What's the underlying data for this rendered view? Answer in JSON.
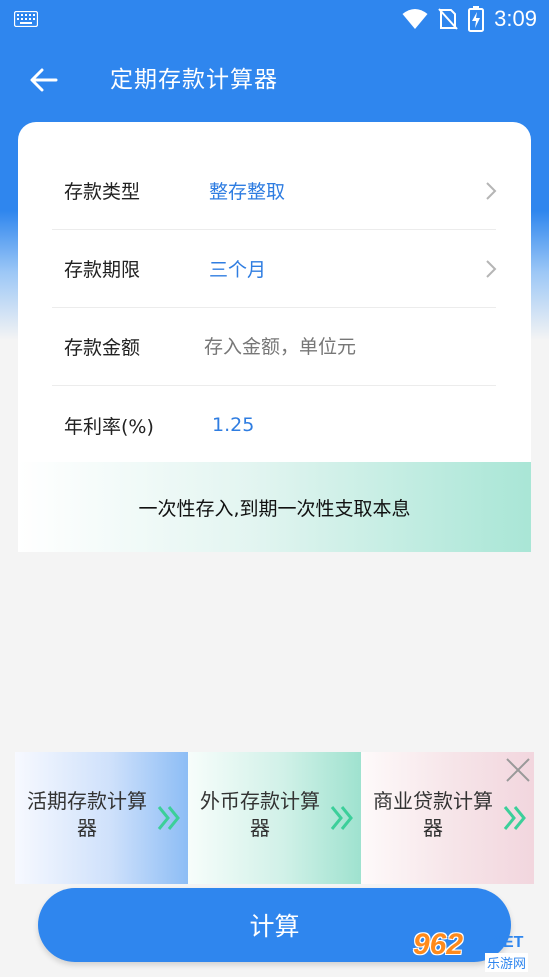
{
  "status_bar": {
    "time": "3:09"
  },
  "header": {
    "title": "定期存款计算器"
  },
  "form": {
    "rows": [
      {
        "label": "存款类型",
        "value": "整存整取"
      },
      {
        "label": "存款期限",
        "value": "三个月"
      },
      {
        "label": "存款金额",
        "value": "",
        "placeholder": "存入金额，单位元"
      },
      {
        "label": "年利率(%)",
        "value": "1.25"
      }
    ],
    "note": "一次性存入,到期一次性支取本息"
  },
  "calculators": [
    {
      "label": "活期存款计算器"
    },
    {
      "label": "外币存款计算器"
    },
    {
      "label": "商业贷款计算器"
    }
  ],
  "calculate_button": "计算",
  "watermark": {
    "number": "962",
    "net": ".NET",
    "sub": "乐游网"
  },
  "colors": {
    "primary": "#2f86ee",
    "value_text": "#2f7de1"
  }
}
